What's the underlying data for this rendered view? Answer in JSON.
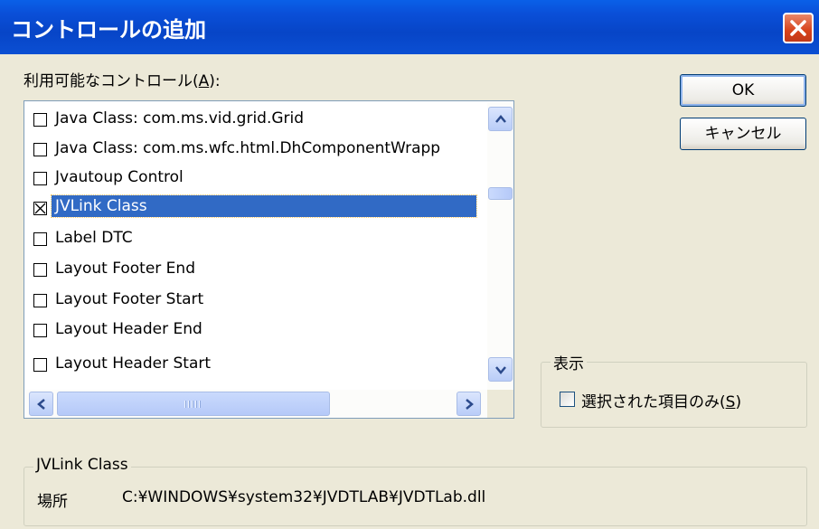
{
  "window": {
    "title": "コントロールの追加"
  },
  "available": {
    "label_before": "利用可能なコントロール(",
    "label_key": "A",
    "label_after": "):"
  },
  "list": {
    "items": [
      {
        "label": "Java Class: com.ms.vid.grid.Grid",
        "checked": false
      },
      {
        "label": "Java Class: com.ms.wfc.html.DhComponentWrapp",
        "checked": false
      },
      {
        "label": "Jvautoup Control",
        "checked": false
      },
      {
        "label": "JVLink Class",
        "checked": true,
        "selected": true
      },
      {
        "label": "Label DTC",
        "checked": false
      },
      {
        "label": "Layout Footer End",
        "checked": false
      },
      {
        "label": "Layout Footer Start",
        "checked": false
      },
      {
        "label": "Layout Header End",
        "checked": false
      },
      {
        "label": "Layout Header Start",
        "checked": false
      }
    ]
  },
  "buttons": {
    "ok": "OK",
    "cancel": "キャンセル"
  },
  "display": {
    "group_title": "表示",
    "selected_only_before": "選択された項目のみ(",
    "selected_only_key": "S",
    "selected_only_after": ")",
    "selected_only_checked": false
  },
  "info": {
    "group_title": "JVLink Class",
    "location_label": "場所",
    "location_value": "C:¥WINDOWS¥system32¥JVDTLAB¥JVDTLab.dll"
  },
  "colors": {
    "titlebar": "#0745c7",
    "selection": "#316ac5",
    "close": "#d8421a"
  }
}
